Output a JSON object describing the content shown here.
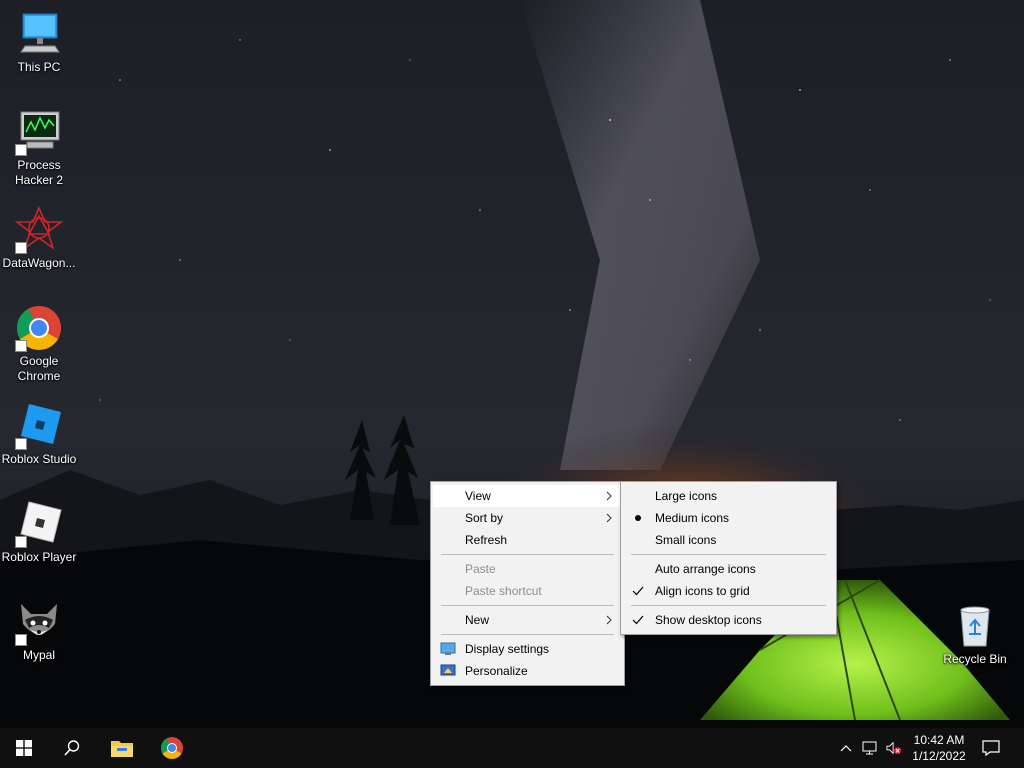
{
  "desktop": {
    "icons": [
      {
        "label": "This PC",
        "icon": "computer-icon"
      },
      {
        "label": "Process\nHacker 2",
        "icon": "process-hacker-icon"
      },
      {
        "label": "DataWagon...",
        "icon": "datawagon-icon"
      },
      {
        "label": "Google\nChrome",
        "icon": "chrome-icon"
      },
      {
        "label": "Roblox Studio",
        "icon": "roblox-studio-icon"
      },
      {
        "label": "Roblox Player",
        "icon": "roblox-player-icon"
      },
      {
        "label": "Mypal",
        "icon": "mypal-icon"
      },
      {
        "label": "Recycle Bin",
        "icon": "recycle-bin-icon"
      }
    ]
  },
  "context_menu": {
    "items": [
      {
        "label": "View"
      },
      {
        "label": "Sort by"
      },
      {
        "label": "Refresh"
      },
      {
        "label": "Paste"
      },
      {
        "label": "Paste shortcut"
      },
      {
        "label": "New"
      },
      {
        "label": "Display settings"
      },
      {
        "label": "Personalize"
      }
    ]
  },
  "view_submenu": {
    "items": [
      {
        "label": "Large icons",
        "mark": ""
      },
      {
        "label": "Medium icons",
        "mark": "bullet"
      },
      {
        "label": "Small icons",
        "mark": ""
      },
      {
        "label": "Auto arrange icons",
        "mark": ""
      },
      {
        "label": "Align icons to grid",
        "mark": "check"
      },
      {
        "label": "Show desktop icons",
        "mark": "check"
      }
    ]
  },
  "taskbar": {
    "pinned": [
      "start-icon",
      "search-icon",
      "file-explorer-icon",
      "chrome-icon"
    ],
    "clock_time": "10:42 AM",
    "clock_date": "1/12/2022"
  },
  "colors": {
    "taskbar_bg": "#101010",
    "menu_bg": "#f2f2f2",
    "menu_hover": "#ffffff",
    "tent_green": "#7ed321"
  }
}
